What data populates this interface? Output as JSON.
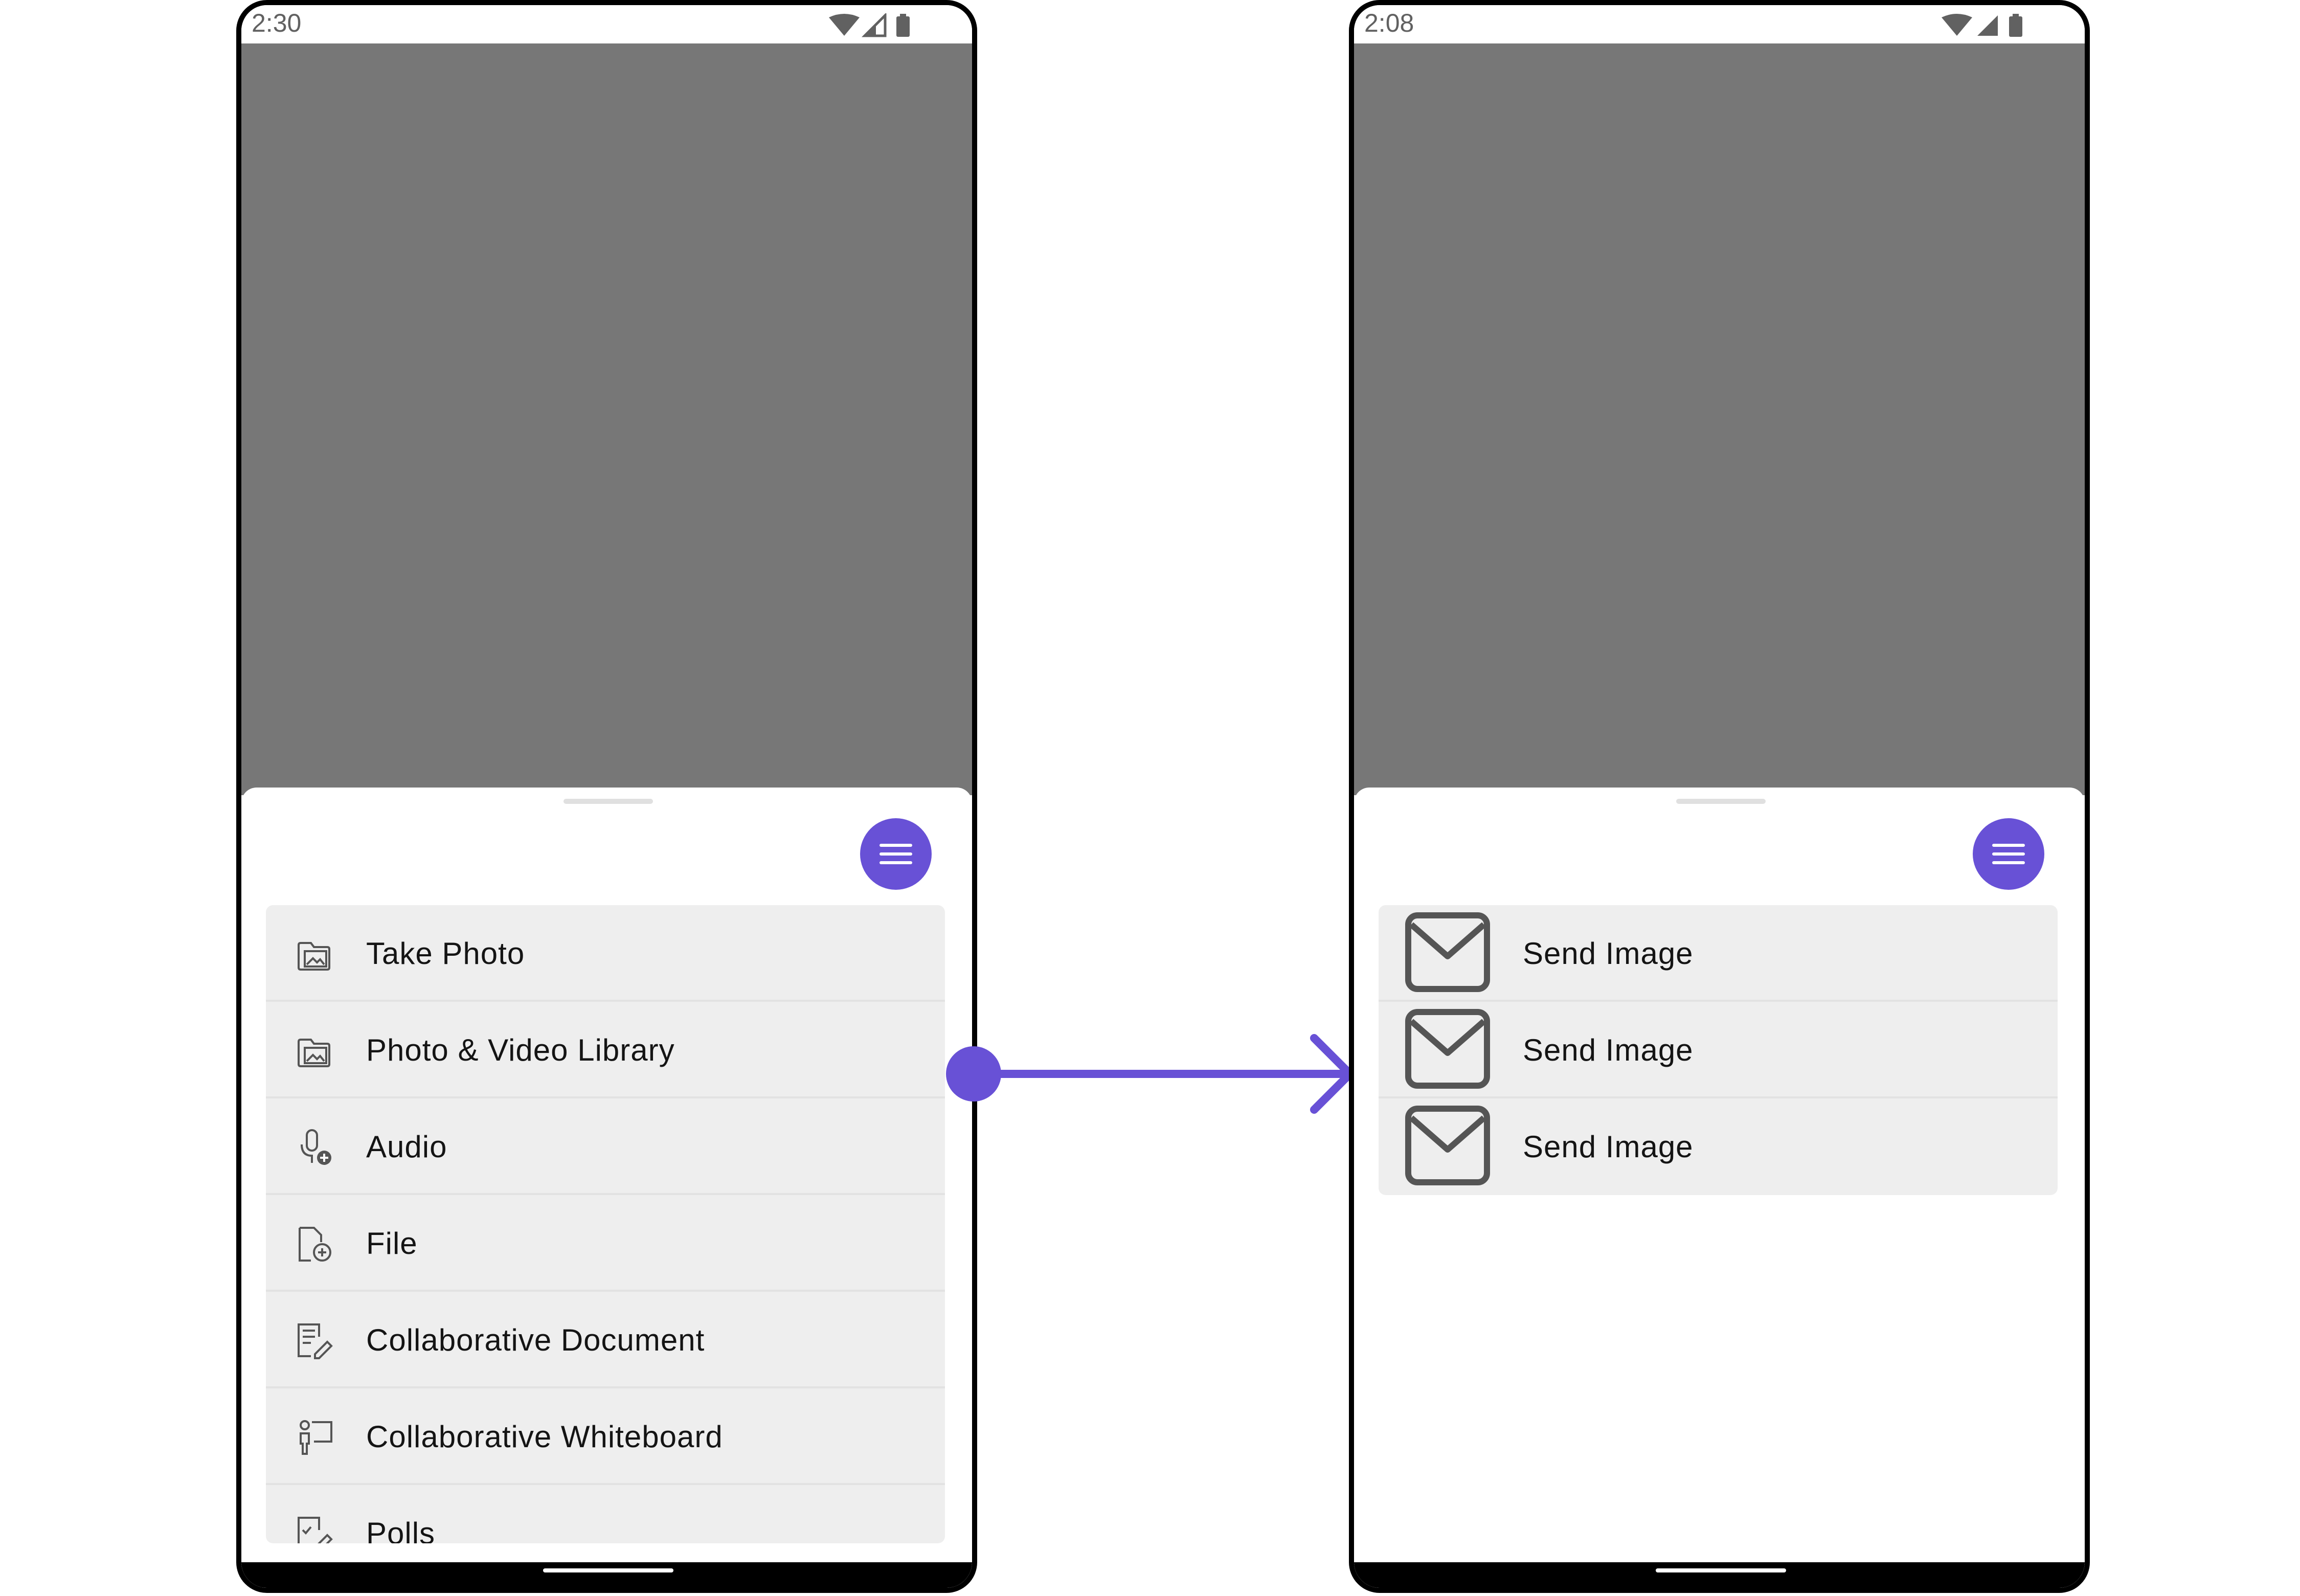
{
  "left_screen": {
    "status_time": "2:30",
    "options": [
      {
        "label": "Take Photo",
        "icon": "folder-image-icon"
      },
      {
        "label": "Photo & Video Library",
        "icon": "folder-image-icon"
      },
      {
        "label": "Audio",
        "icon": "microphone-add-icon"
      },
      {
        "label": "File",
        "icon": "file-add-icon"
      },
      {
        "label": "Collaborative Document",
        "icon": "document-edit-icon"
      },
      {
        "label": "Collaborative Whiteboard",
        "icon": "whiteboard-icon"
      },
      {
        "label": "Polls",
        "icon": "poll-icon"
      }
    ]
  },
  "right_screen": {
    "status_time": "2:08",
    "options": [
      {
        "label": "Send Image",
        "icon": "envelope-icon"
      },
      {
        "label": "Send Image",
        "icon": "envelope-icon"
      },
      {
        "label": "Send Image",
        "icon": "envelope-icon"
      }
    ]
  },
  "colors": {
    "accent": "#6851d6",
    "scrim": "#777777",
    "option_background": "#eeeeee",
    "icon_gray": "#555555"
  }
}
